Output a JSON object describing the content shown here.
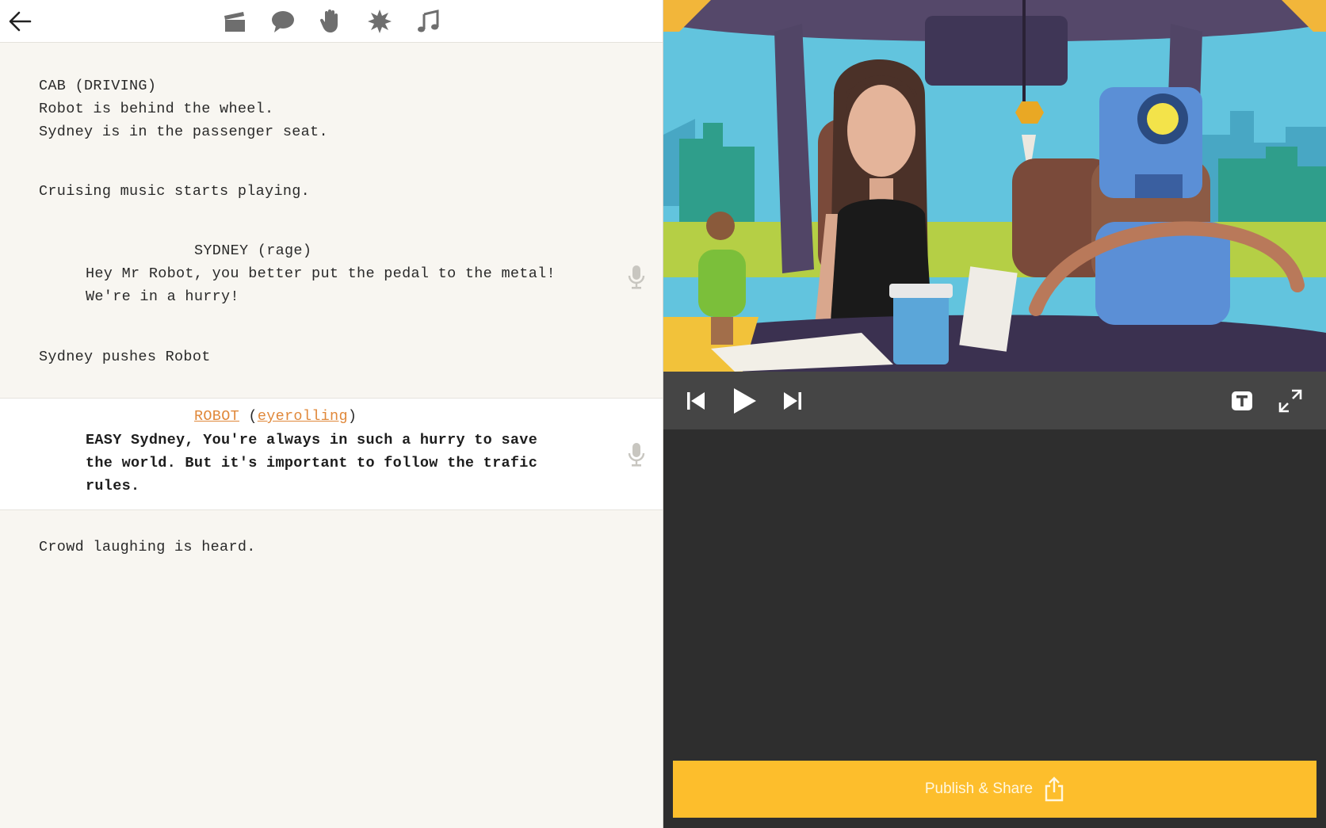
{
  "toolbar": {
    "icons": [
      "back-arrow-icon",
      "clapperboard-icon",
      "speech-bubble-icon",
      "hand-icon",
      "burst-icon",
      "music-note-icon"
    ]
  },
  "script": {
    "scene_heading": "CAB (DRIVING)",
    "action_1": "Robot is behind the wheel.",
    "action_2": "Sydney is in the passenger seat.",
    "action_3": "Cruising music starts playing.",
    "sydney_cue": "SYDNEY (rage)",
    "sydney_line_1": "Hey Mr Robot, you better put the pedal to the metal!",
    "sydney_line_2": "We're in a hurry!",
    "action_4": "Sydney pushes Robot",
    "robot_name": "ROBOT",
    "robot_paren_open": " (",
    "robot_emotion": "eyerolling",
    "robot_paren_close": ")",
    "robot_line_1": "EASY Sydney, You're always in such a hurry to save",
    "robot_line_2": "the world. But it's important to follow the trafic",
    "robot_line_3": "rules.",
    "action_5": "Crowd laughing is heard."
  },
  "player": {
    "controls": [
      "skip-back-icon",
      "play-icon",
      "skip-forward-icon",
      "text-toggle-icon",
      "fullscreen-icon"
    ]
  },
  "publish": {
    "label": "Publish & Share",
    "icon": "share-icon"
  },
  "colors": {
    "accent": "#fdbe2c",
    "link": "#e0883a",
    "editor_bg": "#f8f6f1",
    "preview_bg": "#2e2e2e",
    "controls_bg": "#454545"
  }
}
